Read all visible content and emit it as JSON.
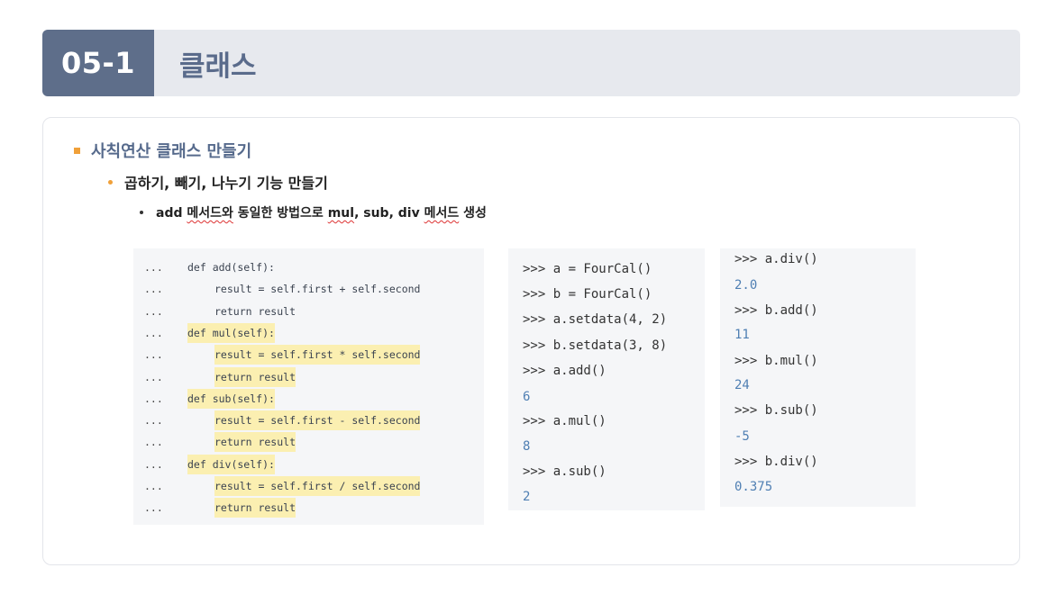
{
  "header": {
    "number": "05-1",
    "title": "클래스"
  },
  "bullets": {
    "level1": "사칙연산 클래스 만들기",
    "level2": "곱하기, 빼기, 나누기 기능 만들기",
    "level3_parts": [
      "add ",
      "메서드와",
      " 동일한 방법으로 ",
      "mul",
      ", sub, div ",
      "메서드",
      " 생성"
    ]
  },
  "code_block": {
    "prefix": "...",
    "lines": [
      {
        "text": "def add(self):",
        "indent": 0,
        "highlight": false
      },
      {
        "text": "result = self.first + self.second",
        "indent": 1,
        "highlight": false
      },
      {
        "text": "return result",
        "indent": 1,
        "highlight": false
      },
      {
        "text": "def mul(self):",
        "indent": 0,
        "highlight": true
      },
      {
        "text": "result = self.first * self.second",
        "indent": 1,
        "highlight": true
      },
      {
        "text": "return result",
        "indent": 1,
        "highlight": true
      },
      {
        "text": "def sub(self):",
        "indent": 0,
        "highlight": true
      },
      {
        "text": "result = self.first - self.second",
        "indent": 1,
        "highlight": true
      },
      {
        "text": "return result",
        "indent": 1,
        "highlight": true
      },
      {
        "text": "def div(self):",
        "indent": 0,
        "highlight": true
      },
      {
        "text": "result = self.first / self.second",
        "indent": 1,
        "highlight": true
      },
      {
        "text": "return result",
        "indent": 1,
        "highlight": true
      }
    ]
  },
  "repl1": [
    {
      "text": ">>> a = FourCal()",
      "type": "prompt"
    },
    {
      "text": ">>> b = FourCal()",
      "type": "prompt"
    },
    {
      "text": ">>> a.setdata(4, 2)",
      "type": "prompt"
    },
    {
      "text": ">>> b.setdata(3, 8)",
      "type": "prompt"
    },
    {
      "text": ">>> a.add()",
      "type": "prompt"
    },
    {
      "text": "6",
      "type": "output"
    },
    {
      "text": ">>> a.mul()",
      "type": "prompt"
    },
    {
      "text": "8",
      "type": "output"
    },
    {
      "text": ">>> a.sub()",
      "type": "prompt"
    },
    {
      "text": "2",
      "type": "output"
    }
  ],
  "repl2": [
    {
      "text": ">>> a.div()",
      "type": "prompt"
    },
    {
      "text": "2.0",
      "type": "output"
    },
    {
      "text": ">>> b.add()",
      "type": "prompt"
    },
    {
      "text": "11",
      "type": "output"
    },
    {
      "text": ">>> b.mul()",
      "type": "prompt"
    },
    {
      "text": "24",
      "type": "output"
    },
    {
      "text": ">>> b.sub()",
      "type": "prompt"
    },
    {
      "text": "-5",
      "type": "output"
    },
    {
      "text": ">>> b.div()",
      "type": "prompt"
    },
    {
      "text": "0.375",
      "type": "output"
    }
  ],
  "colors": {
    "header_number_bg": "#5e6e8a",
    "header_bar_bg": "#e7e9ee",
    "accent": "#f0a039",
    "highlight": "#fbefb1",
    "output_text": "#4f7fb3"
  }
}
